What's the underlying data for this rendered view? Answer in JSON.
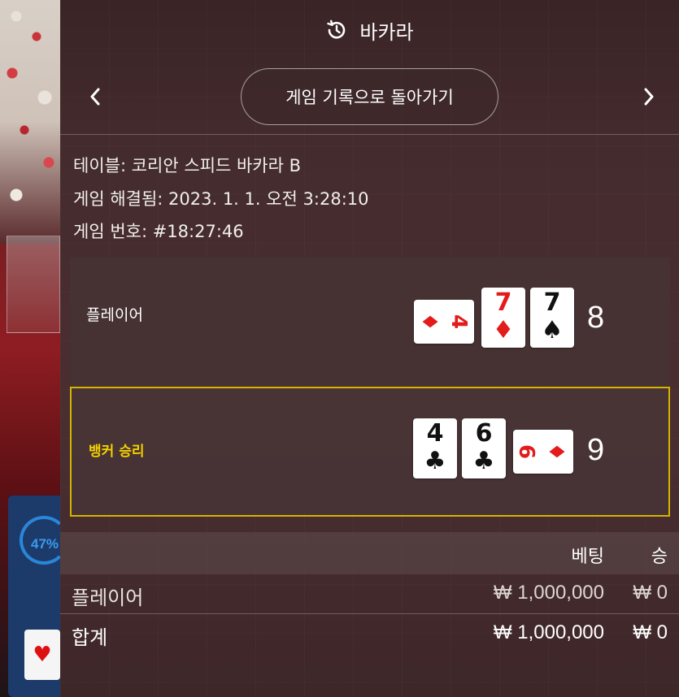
{
  "background": {
    "percent": "47%",
    "card_suit": "♥"
  },
  "header": {
    "title": "바카라",
    "icon": "history-icon"
  },
  "nav": {
    "back_label": "게임 기록으로 돌아가기",
    "prev_icon": "chevron-left-icon",
    "next_icon": "chevron-right-icon"
  },
  "info": {
    "table": "테이블: 코리안 스피드 바카라 B",
    "resolved": "게임 해결됨: 2023. 1. 1. 오전 3:28:10",
    "game_number": "게임 번호: #18:27:46"
  },
  "player": {
    "label": "플레이어",
    "score": "8",
    "cards": [
      {
        "rank": "4",
        "suit": "♦",
        "color": "red",
        "orientation": "sideways"
      },
      {
        "rank": "7",
        "suit": "♦",
        "color": "red",
        "orientation": "upright"
      },
      {
        "rank": "7",
        "suit": "♠",
        "color": "black",
        "orientation": "upright"
      }
    ]
  },
  "banker": {
    "label": "뱅커 승리",
    "score": "9",
    "cards": [
      {
        "rank": "4",
        "suit": "♣",
        "color": "black",
        "orientation": "upright"
      },
      {
        "rank": "6",
        "suit": "♣",
        "color": "black",
        "orientation": "upright"
      },
      {
        "rank": "9",
        "suit": "♦",
        "color": "red",
        "orientation": "sideways"
      }
    ]
  },
  "table": {
    "headers": {
      "bet": "베팅",
      "win": "승"
    },
    "rows": [
      {
        "label": "플레이어",
        "bet": "₩ 1,000,000",
        "win": "₩ 0"
      },
      {
        "label": "합계",
        "bet": "₩ 1,000,000",
        "win": "₩ 0"
      }
    ]
  },
  "colors": {
    "win_highlight": "#d4b400",
    "card_red": "#e31b1b",
    "panel_bg": "#442b2d"
  }
}
